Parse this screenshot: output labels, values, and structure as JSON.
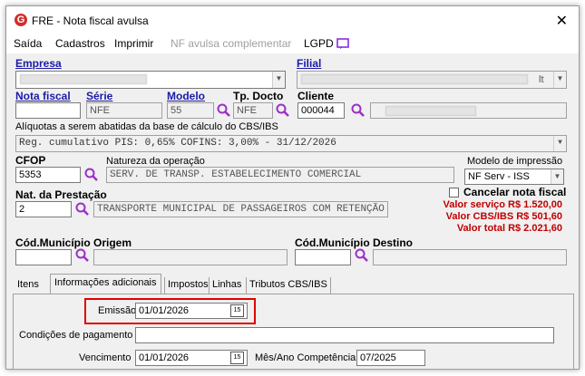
{
  "window": {
    "title": "FRE - Nota fiscal avulsa",
    "close": "✕",
    "logo": "G"
  },
  "menu": {
    "saida": "Saída",
    "cadastros": "Cadastros",
    "imprimir": "Imprimir",
    "nf_complementar": "NF avulsa complementar",
    "lgpd": "LGPD"
  },
  "labels": {
    "empresa": "Empresa",
    "filial": "Filial",
    "nota_fiscal": "Nota fiscal",
    "serie": "Série",
    "modelo": "Modelo",
    "tp_docto": "Tp. Docto",
    "cliente": "Cliente",
    "aliquotas": "Alíquotas a serem abatidas da base de cálculo do CBS/IBS",
    "cfop": "CFOP",
    "natureza": "Natureza da operação",
    "modelo_impressao": "Modelo de impressão",
    "nat_prestacao": "Nat. da Prestação",
    "cancelar": "Cancelar nota fiscal",
    "cod_mun_origem": "Cód.Município Origem",
    "cod_mun_destino": "Cód.Município Destino"
  },
  "values": {
    "serie": "NFE",
    "modelo": "55",
    "tp_docto": "NFE",
    "cliente": "000044",
    "aliquotas": "Reg. cumulativo PIS: 0,65% COFINS: 3,00% - 31/12/2026",
    "cfop": "5353",
    "natureza": "SERV. DE TRANSP. ESTABELECIMENTO COMERCIAL",
    "modelo_impressao": "NF Serv - ISS",
    "nat_prestacao": "2",
    "nat_prestacao_desc": "TRANSPORTE MUNICIPAL DE PASSAGEIROS COM RETENÇÃO",
    "filial_suffix": "lt"
  },
  "totals": {
    "servico": "Valor serviço R$ 1.520,00",
    "cbs_ibs": "Valor CBS/IBS R$ 501,60",
    "total": "Valor total R$ 2.021,60"
  },
  "tabs": [
    "Itens",
    "Informações adicionais",
    "Impostos",
    "Linhas",
    "Tributos CBS/IBS"
  ],
  "info": {
    "emissao_label": "Emissão",
    "emissao": "01/01/2026",
    "condicoes_label": "Condições de pagamento",
    "vencimento_label": "Vencimento",
    "vencimento": "01/01/2026",
    "competencia_label": "Mês/Ano Competência",
    "competencia": "07/2025",
    "cal": "15"
  },
  "colors": {
    "accent": "#1a1aa8",
    "red": "#c00000",
    "highlight": "#e00000"
  }
}
